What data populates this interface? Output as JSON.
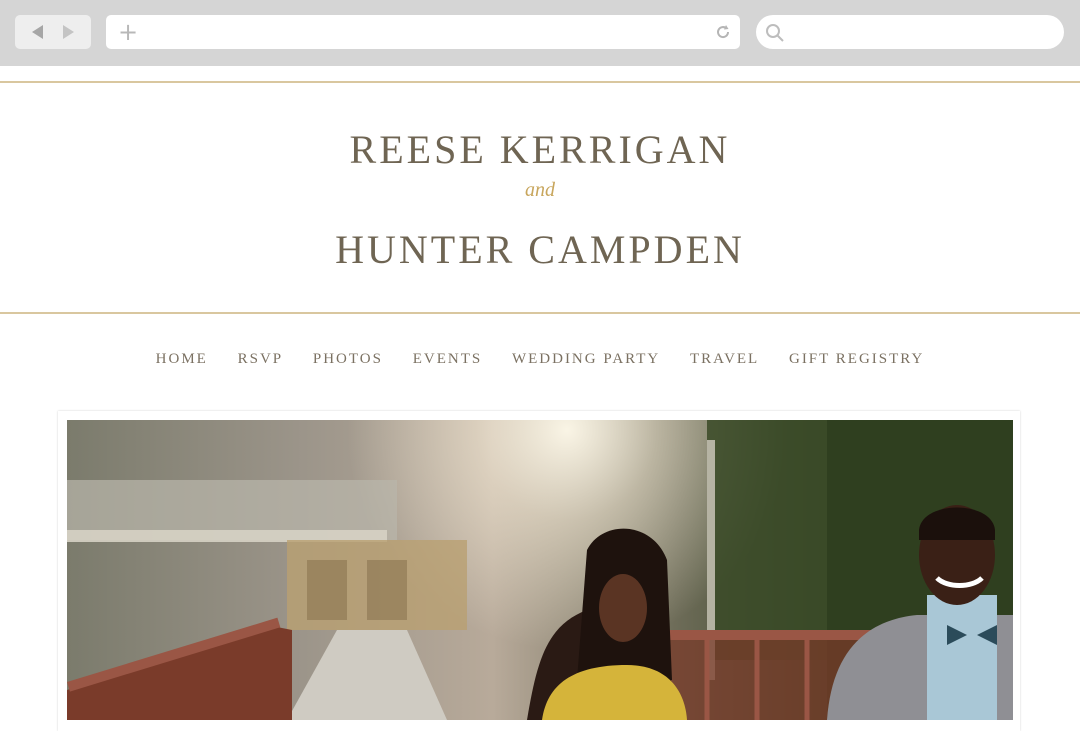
{
  "site": {
    "name_one": "REESE KERRIGAN",
    "joiner": "and",
    "name_two": "HUNTER CAMPDEN"
  },
  "nav": {
    "items": [
      "HOME",
      "RSVP",
      "PHOTOS",
      "EVENTS",
      "WEDDING PARTY",
      "TRAVEL",
      "GIFT REGISTRY"
    ]
  },
  "colors": {
    "accent_gold": "#c8a65d",
    "text": "#6f6553",
    "chrome": "#d5d5d5"
  },
  "icons": {
    "back": "chevron-left-icon",
    "forward": "chevron-right-icon",
    "new_tab": "plus-icon",
    "reload": "reload-icon",
    "search": "search-icon"
  },
  "photo": {
    "description": "engagement photo"
  }
}
